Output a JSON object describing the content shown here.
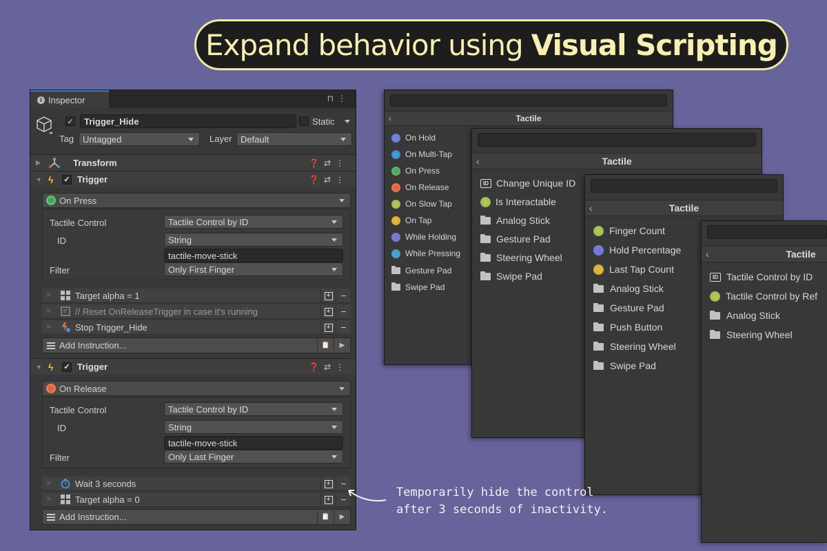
{
  "banner": {
    "prefix": "Expand behavior using",
    "highlight": "Visual Scripting"
  },
  "inspector": {
    "tab_label": "Inspector",
    "object_name": "Trigger_Hide",
    "static_label": "Static",
    "tag_label": "Tag",
    "tag_value": "Untagged",
    "layer_label": "Layer",
    "layer_value": "Default",
    "transform_label": "Transform",
    "triggers": [
      {
        "label": "Trigger",
        "event": "On Press",
        "tactile_control_label": "Tactile Control",
        "tactile_control_value": "Tactile Control by ID",
        "id_label": "ID",
        "id_type": "String",
        "id_value": "tactile-move-stick",
        "filter_label": "Filter",
        "filter_value": "Only First Finger",
        "instructions": [
          "Target alpha = 1",
          "// Reset OnReleaseTrigger in case it's running",
          "Stop Trigger_Hide"
        ],
        "add_label": "Add Instruction..."
      },
      {
        "label": "Trigger",
        "event": "On Release",
        "tactile_control_label": "Tactile Control",
        "tactile_control_value": "Tactile Control by ID",
        "id_label": "ID",
        "id_type": "String",
        "id_value": "tactile-move-stick",
        "filter_label": "Filter",
        "filter_value": "Only Last Finger",
        "instructions": [
          "Wait 3 seconds",
          "Target alpha = 0"
        ],
        "add_label": "Add Instruction..."
      }
    ]
  },
  "menus": [
    {
      "title": "Tactile",
      "items": [
        "On Hold",
        "On Multi-Tap",
        "On Press",
        "On Release",
        "On Slow Tap",
        "On Tap",
        "While Holding",
        "While Pressing",
        "Gesture Pad",
        "Swipe Pad"
      ]
    },
    {
      "title": "Tactile",
      "items": [
        "Change Unique ID",
        "Is Interactable",
        "Analog Stick",
        "Gesture Pad",
        "Steering Wheel",
        "Swipe Pad"
      ]
    },
    {
      "title": "Tactile",
      "items": [
        "Finger Count",
        "Hold Percentage",
        "Last Tap Count",
        "Analog Stick",
        "Gesture Pad",
        "Push Button",
        "Steering Wheel",
        "Swipe Pad"
      ]
    },
    {
      "title": "Tactile",
      "items": [
        "Tactile Control by ID",
        "Tactile Control by Ref",
        "Analog Stick",
        "Steering Wheel"
      ]
    }
  ],
  "annotation": {
    "line1": "Temporarily hide the control",
    "line2": "after 3 seconds of inactivity."
  },
  "colors": {
    "background": "#67639b",
    "banner_bg": "#1d1d1d",
    "banner_text": "#f7f0b0",
    "accent_blue": "#3a79bb"
  }
}
